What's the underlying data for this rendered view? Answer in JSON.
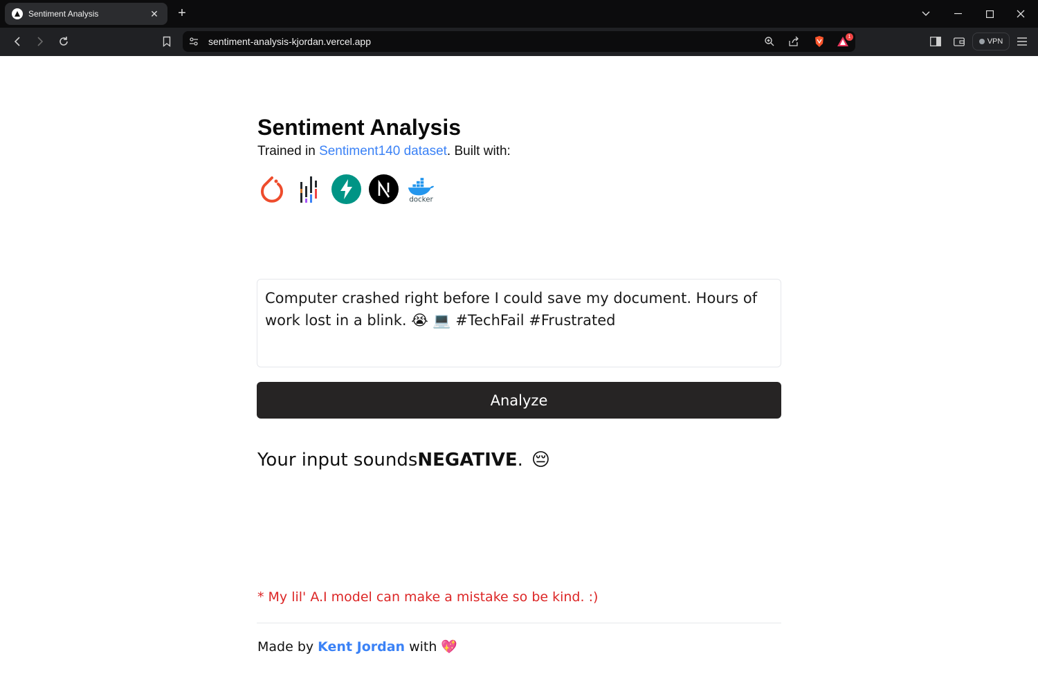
{
  "browser": {
    "tab_title": "Sentiment Analysis",
    "url": "sentiment-analysis-kjordan.vercel.app",
    "vpn_label": "VPN",
    "notification_count": "1"
  },
  "header": {
    "title": "Sentiment Analysis",
    "trained_prefix": "Trained in ",
    "dataset_link": "Sentiment140 dataset",
    "built_with": ". Built with:",
    "tech_logos": [
      "pytorch-logo",
      "polars-logo",
      "fastapi-logo",
      "nextjs-logo",
      "docker-logo"
    ],
    "docker_text": "docker"
  },
  "input": {
    "text": "Computer crashed right before I could save my document. Hours of work lost in a blink. 😭 💻 #TechFail #Frustrated"
  },
  "analyze_button": "Analyze",
  "result": {
    "prefix": "Your input sounds ",
    "sentiment": "NEGATIVE",
    "suffix": ".",
    "emoji": "😔"
  },
  "disclaimer": "* My lil' A.I model can make a mistake so be kind. :)",
  "footer": {
    "made_by": "Made by",
    "author": "Kent Jordan",
    "with": "with",
    "heart": "💖"
  },
  "colors": {
    "link": "#3b82f6",
    "button_bg": "#262424",
    "disclaimer": "#dc2626"
  }
}
